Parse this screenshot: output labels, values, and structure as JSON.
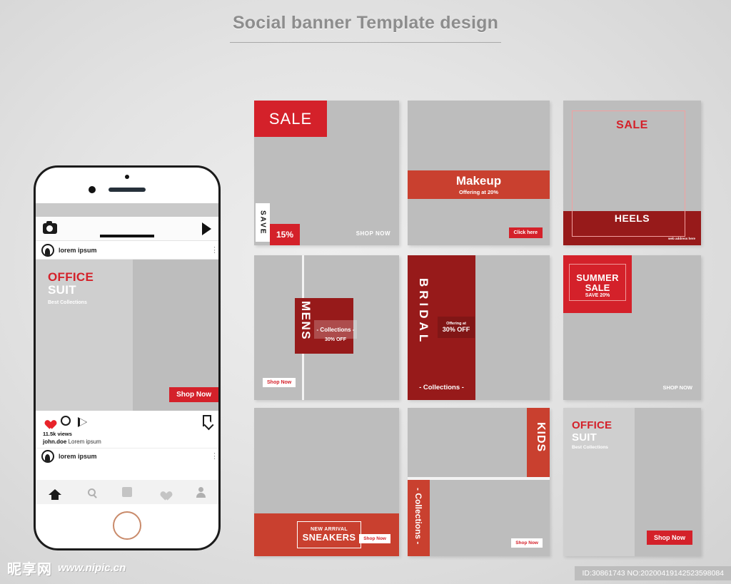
{
  "header": {
    "title": "Social banner Template design"
  },
  "phone": {
    "post_user": "lorem ipsum",
    "post_user2": "lorem ipsum",
    "media": {
      "line1": "OFFICE",
      "line2": "SUIT",
      "line3": "Best Collections",
      "cta": "Shop Now"
    },
    "views": "11.5k views",
    "caption_user": "john.doe",
    "caption_text": "Lorem ipsum",
    "icons": {
      "camera": "camera-icon",
      "send": "send-icon",
      "heart": "heart-icon",
      "comment": "comment-icon",
      "share": "share-icon",
      "bookmark": "bookmark-icon",
      "more": "more-options-icon",
      "tab_home": "home-icon",
      "tab_search": "search-icon",
      "tab_reels": "reels-icon",
      "tab_activity": "heart-icon",
      "tab_profile": "profile-icon"
    }
  },
  "cards": {
    "sale": {
      "badge": "SALE",
      "save": "SAVE",
      "percent": "15%",
      "cta": "SHOP NOW"
    },
    "makeup": {
      "title": "Makeup",
      "subtitle": "Offering at 20%",
      "cta": "Click here"
    },
    "heels": {
      "sale": "SALE",
      "title": "HEELS",
      "web": "web address here"
    },
    "mens": {
      "title": "MENS",
      "collections": "- Collections -",
      "discount": "30% OFF",
      "cta": "Shop Now"
    },
    "bridal": {
      "title": "BRIDAL",
      "offering": "Offering at",
      "discount": "30% OFF",
      "collections": "- Collections -"
    },
    "summer": {
      "line1": "SUMMER",
      "line2": "SALE",
      "line3": "SAVE 20%",
      "cta": "SHOP NOW"
    },
    "sneakers": {
      "eyebrow": "NEW ARRIVAL",
      "title": "SNEAKERS",
      "cta": "Shop Now"
    },
    "kids": {
      "title": "KIDS",
      "collections": "- Collections -",
      "cta": "Shop Now"
    },
    "office": {
      "line1": "OFFICE",
      "line2": "SUIT",
      "line3": "Best Collections",
      "cta": "Shop Now"
    }
  },
  "footer": {
    "logo": "昵享网",
    "url": "www.nipic.cn",
    "id": "ID:30861743 NO:20200419142523598084"
  },
  "colors": {
    "red_bright": "#D4212A",
    "red_mid": "#C9402F",
    "red_dark": "#971A1A",
    "gray_card": "#BDBDBD",
    "gray_light": "#CFCFCF"
  }
}
